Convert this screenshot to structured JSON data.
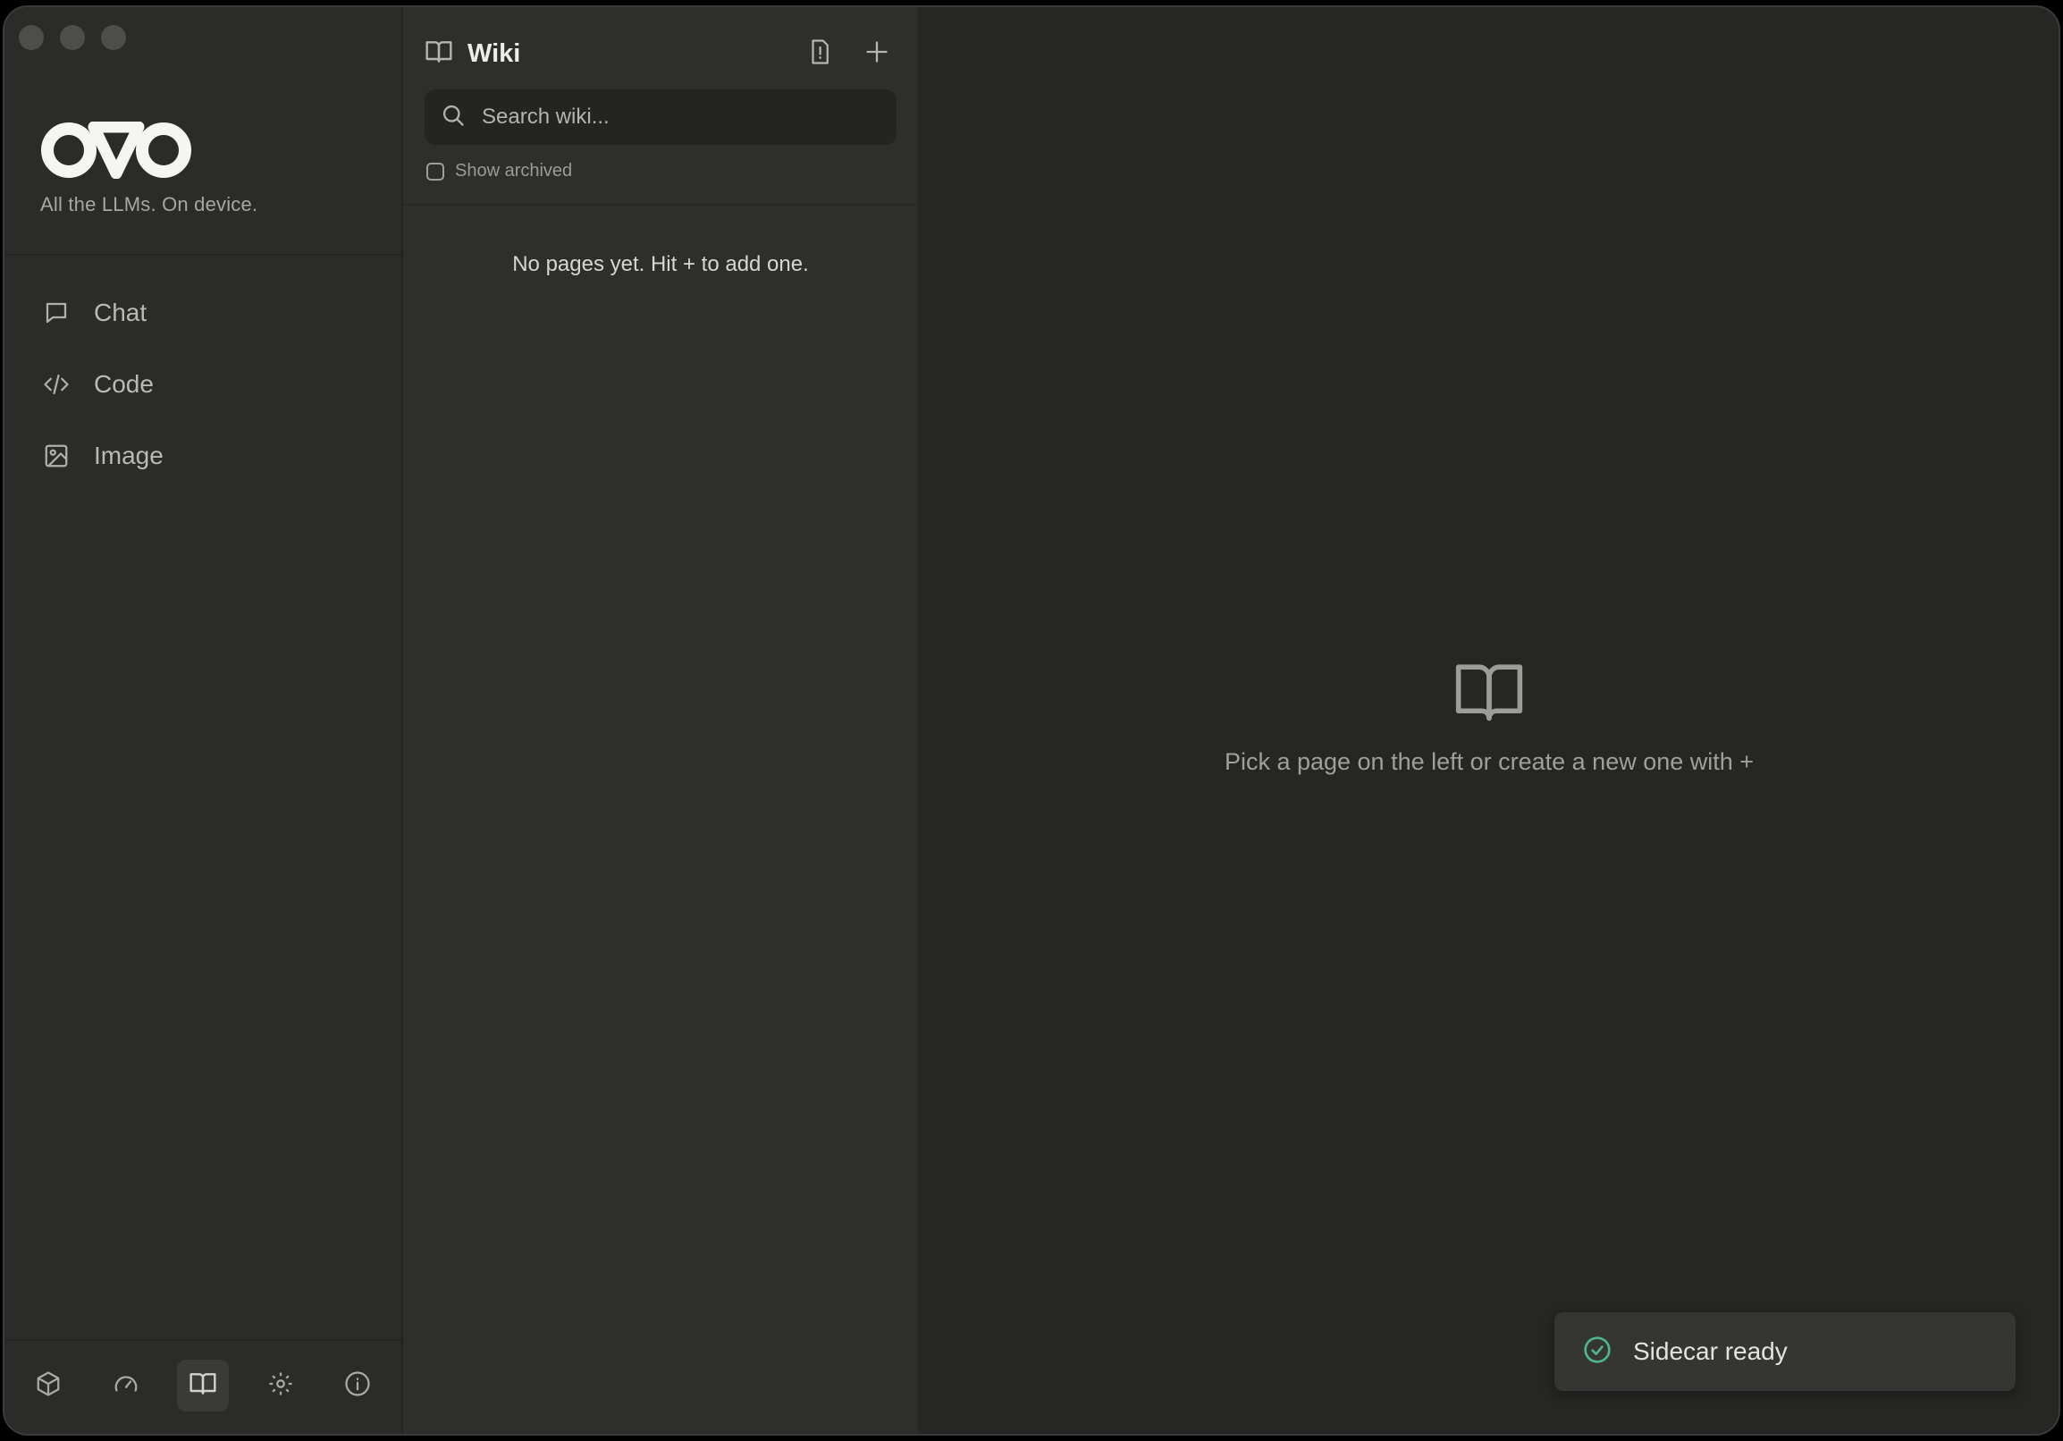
{
  "app": {
    "brand": "OVO",
    "tagline": "All the LLMs. On device."
  },
  "window_controls": [
    "close-button",
    "minimize-button",
    "zoom-button"
  ],
  "sidebar": {
    "items": [
      {
        "label": "Chat",
        "icon": "chat-bubble-icon"
      },
      {
        "label": "Code",
        "icon": "code-icon"
      },
      {
        "label": "Image",
        "icon": "image-icon"
      }
    ],
    "footer_icons": [
      {
        "name": "models-cube-icon",
        "active": false
      },
      {
        "name": "performance-gauge-icon",
        "active": false
      },
      {
        "name": "wiki-book-icon",
        "active": true
      },
      {
        "name": "settings-gear-icon",
        "active": false
      },
      {
        "name": "info-icon",
        "active": false
      }
    ]
  },
  "wiki": {
    "title": "Wiki",
    "search_placeholder": "Search wiki...",
    "show_archived_label": "Show archived",
    "show_archived_checked": false,
    "empty_message": "No pages yet. Hit + to add one."
  },
  "main": {
    "placeholder": "Pick a page on the left or create a new one with +"
  },
  "toast": {
    "message": "Sidecar ready",
    "status_color": "#4fb58a"
  },
  "colors": {
    "background": "#262625",
    "sidebar": "#2b2b2a",
    "panel": "#2e2e2d",
    "accent_success": "#4fb58a"
  }
}
